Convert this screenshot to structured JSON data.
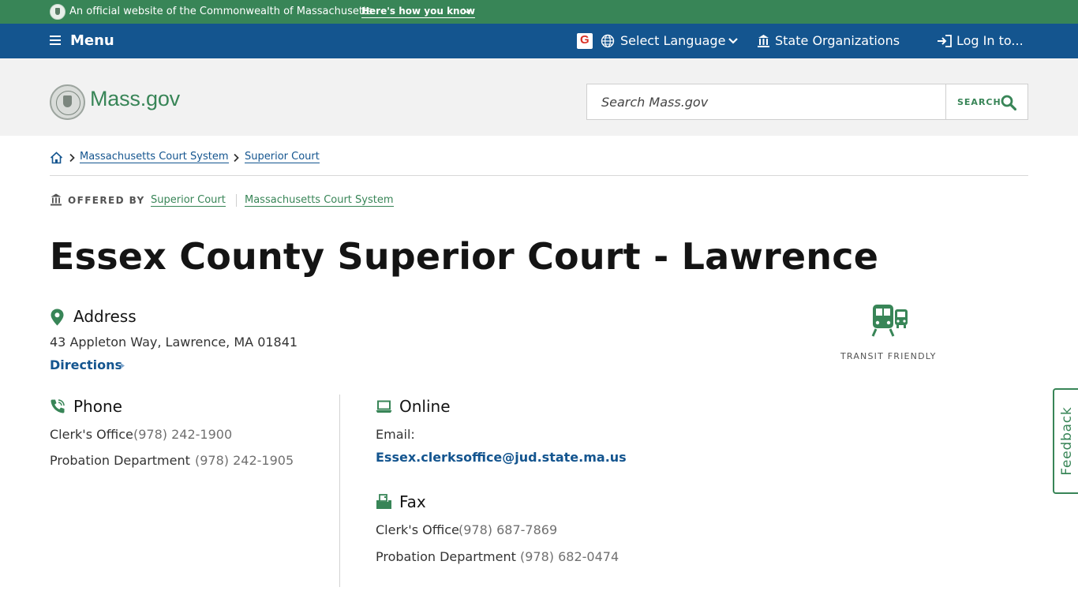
{
  "official_banner": {
    "text": "An official website of the Commonwealth of Massachusetts",
    "toggle_label": "Here's how you know"
  },
  "nav": {
    "menu_label": "Menu",
    "language_label": "Select Language",
    "orgs_label": "State Organizations",
    "login_label": "Log In to..."
  },
  "header": {
    "logo_text": "Mass.gov",
    "search_placeholder": "Search Mass.gov",
    "search_button": "SEARCH"
  },
  "breadcrumb": {
    "items": [
      "Massachusetts Court System",
      "Superior Court"
    ]
  },
  "offered_by": {
    "label": "OFFERED BY",
    "orgs": [
      "Superior Court",
      "Massachusetts Court System"
    ]
  },
  "page_title": "Essex County Superior Court - Lawrence",
  "address": {
    "heading": "Address",
    "line": "43 Appleton Way, Lawrence, MA 01841",
    "directions_label": "Directions"
  },
  "transit": {
    "label": "TRANSIT FRIENDLY"
  },
  "phone": {
    "heading": "Phone",
    "entries": [
      {
        "label": "Clerk's Office",
        "number": "(978) 242-1900"
      },
      {
        "label": "Probation Department",
        "number": "(978) 242-1905"
      }
    ]
  },
  "online": {
    "heading": "Online",
    "email_label": "Email:",
    "email": "Essex.clerksoffice@jud.state.ma.us"
  },
  "fax": {
    "heading": "Fax",
    "entries": [
      {
        "label": "Clerk's Office",
        "number": "(978) 687-7869"
      },
      {
        "label": "Probation Department",
        "number": "(978) 682-0474"
      }
    ]
  },
  "feedback_label": "Feedback",
  "colors": {
    "green": "#388557",
    "blue": "#14558f",
    "banner_green": "#388557"
  }
}
